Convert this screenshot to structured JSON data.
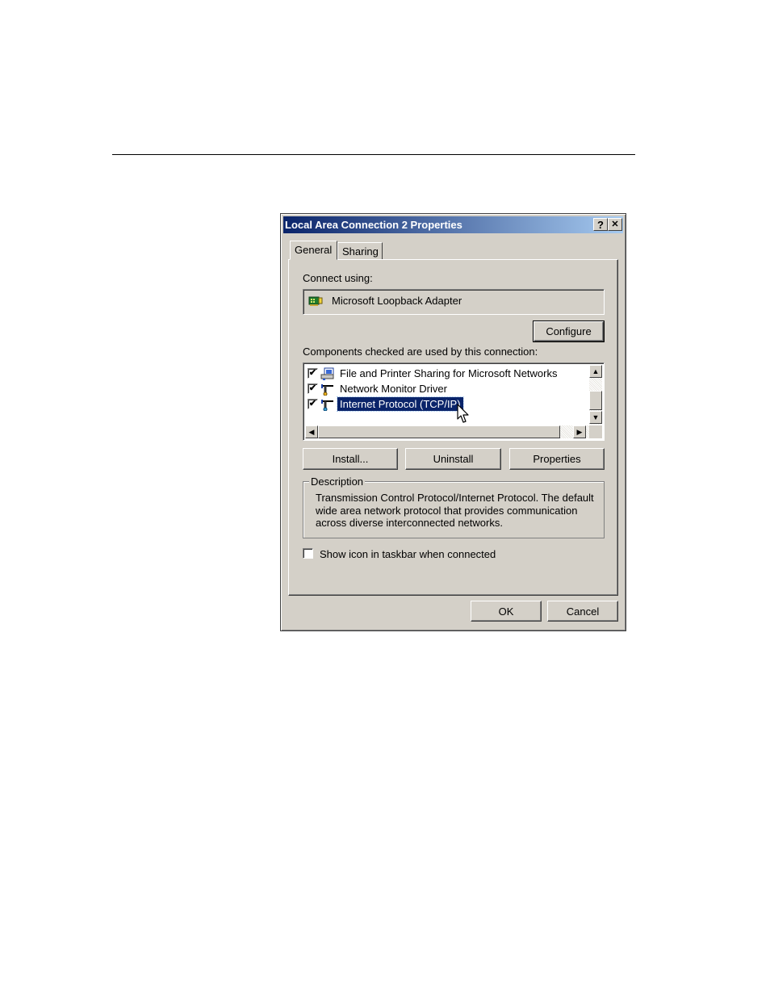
{
  "dialog": {
    "title": "Local Area Connection 2 Properties",
    "help_glyph": "?",
    "close_glyph": "✕"
  },
  "tabs": [
    {
      "label": "General",
      "active": true
    },
    {
      "label": "Sharing",
      "active": false
    }
  ],
  "general": {
    "connect_using_label": "Connect using:",
    "adapter_name": "Microsoft Loopback Adapter",
    "adapter_icon": "network-card-icon",
    "configure_label": "Configure",
    "components_label": "Components checked are used by this connection:",
    "components": [
      {
        "label": "File and Printer Sharing for Microsoft Networks",
        "checked": true,
        "icon": "file-printer-sharing-icon",
        "selected": false
      },
      {
        "label": "Network Monitor Driver",
        "checked": true,
        "icon": "network-protocol-icon",
        "selected": false
      },
      {
        "label": "Internet Protocol (TCP/IP)",
        "checked": true,
        "icon": "network-protocol-icon",
        "selected": true
      }
    ],
    "install_label": "Install...",
    "uninstall_label": "Uninstall",
    "properties_label": "Properties",
    "description_legend": "Description",
    "description_text": "Transmission Control Protocol/Internet Protocol. The default wide area network protocol that provides communication across diverse interconnected networks.",
    "show_icon_label": "Show icon in taskbar when connected",
    "show_icon_checked": false
  },
  "footer": {
    "ok_label": "OK",
    "cancel_label": "Cancel"
  },
  "check_glyph": "✔",
  "colors": {
    "title_start": "#0a246a",
    "title_end": "#a6caf0",
    "face": "#d4d0c8",
    "selection": "#0a246a"
  }
}
